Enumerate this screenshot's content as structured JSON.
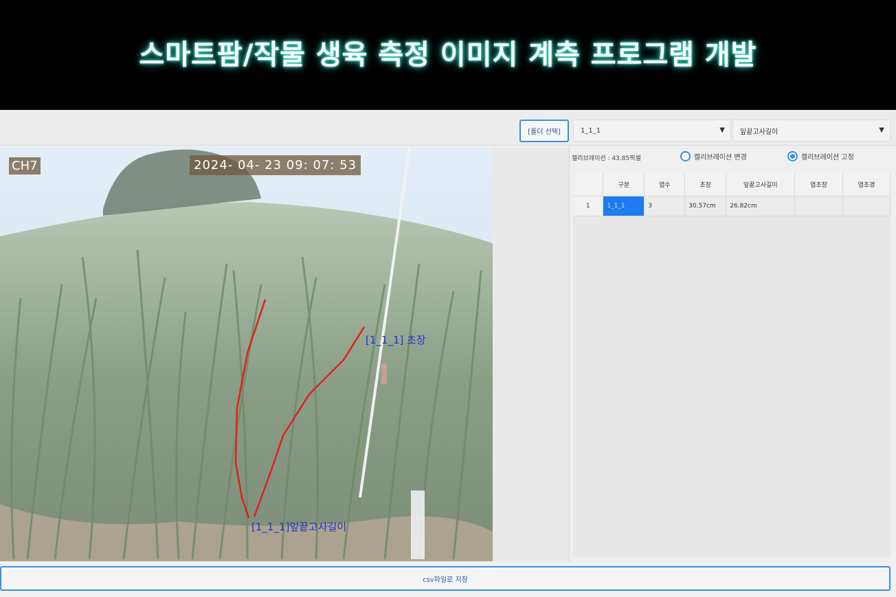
{
  "banner": {
    "title": "스마트팜/작물 생육 측정 이미지 계측 프로그램 개발"
  },
  "toolbar": {
    "folder_button": "[폴더 선택]",
    "sample_select": "1_1_1",
    "metric_select": "잎끝고사길이"
  },
  "image": {
    "channel": "CH7",
    "timestamp": "2024- 04- 23  09: 07: 53",
    "overlay_label_1": "[1_1_1] 초장",
    "overlay_label_2": "[1_1_1]잎끝고사길이",
    "line_color": "#e0201e",
    "label_color": "#2030d0"
  },
  "calibration": {
    "text": "캘리브레이션 : 43.85픽셀",
    "option_change": "캘리브레이션 변경",
    "option_fixed": "캘리브레이션 고정",
    "selected": "캘리브레이션 고정"
  },
  "table": {
    "headers": [
      "",
      "구분",
      "엽수",
      "초장",
      "잎끝고사길이",
      "엽초장",
      "엽초경"
    ],
    "rows": [
      [
        "1",
        "1_1_1",
        "3",
        "30.57cm",
        "26.82cm",
        "",
        ""
      ]
    ]
  },
  "footer": {
    "csv_button": "csv파일로 저장"
  },
  "colors": {
    "accent": "#3a8ee6",
    "selected_cell": "#1e7cf0",
    "panel_bg": "#f0f0f0"
  }
}
